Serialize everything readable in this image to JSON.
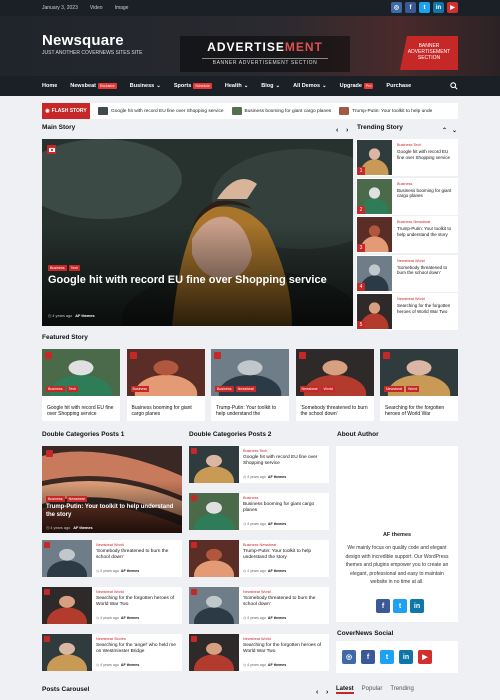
{
  "topbar": {
    "date": "January 3, 2023",
    "links": [
      "Video",
      "Image"
    ]
  },
  "social": [
    {
      "name": "instagram-icon",
      "glyph": "◎",
      "color": "#3e6aa5"
    },
    {
      "name": "facebook-icon",
      "glyph": "f",
      "color": "#3b5998"
    },
    {
      "name": "twitter-icon",
      "glyph": "t",
      "color": "#1da1f2"
    },
    {
      "name": "linkedin-icon",
      "glyph": "in",
      "color": "#0e76a8"
    },
    {
      "name": "youtube-icon",
      "glyph": "▶",
      "color": "#d32f2f"
    }
  ],
  "header": {
    "site_title": "Newsquare",
    "tagline": "JUST ANOTHER COVERNEWS SITES SITE",
    "ad_title_a": "ADVERTISE",
    "ad_title_b": "MENT",
    "ad_sub": "BANNER ADVERTISEMENT SECTION",
    "ad_banner": "BANNER ADVERTISEMENT SECTION"
  },
  "nav": {
    "home": "Home",
    "newsbeat": "Newsbeat",
    "exclusive": "Exclusive",
    "business": "Business",
    "sports": "Sports",
    "schedule": "Schedule",
    "health": "Health",
    "blog": "Blog",
    "all_demos": "All Demos",
    "upgrade": "Upgrade",
    "pro": "Pro",
    "purchase": "Purchase"
  },
  "flash": {
    "label": "FLASH STORY",
    "items": [
      "Google hit with record EU fine over Shopping service",
      "Business booming for giant cargo planes",
      "Trump-Putin: Your toolkit to help unde"
    ]
  },
  "sections": {
    "main": "Main Story",
    "trending": "Trending Story",
    "featured": "Featured Story",
    "dc1": "Double Categories Posts 1",
    "dc2": "Double Categories Posts 2",
    "about": "About Author",
    "social": "CoverNews Social",
    "carousel": "Posts Carousel"
  },
  "main_story": {
    "cats": [
      "Business",
      "Tech"
    ],
    "title": "Google hit with record EU fine over Shopping service",
    "time": "4 years ago",
    "author": "AF themes"
  },
  "trending": [
    {
      "num": "1",
      "cat": "Business Tech",
      "title": "Google hit with record EU fine over Shopping service"
    },
    {
      "num": "2",
      "cat": "Business",
      "title": "Business booming for giant cargo planes"
    },
    {
      "num": "3",
      "cat": "Business Newsbeat",
      "title": "Trump-Putin: Your toolkit to help understand the story"
    },
    {
      "num": "4",
      "cat": "Newsbeat World",
      "title": "'Somebody threatened to burn the school down'"
    },
    {
      "num": "5",
      "cat": "Newsbeat World",
      "title": "Searching for the forgotten heroes of World War Two"
    }
  ],
  "featured": [
    {
      "cats": [
        "Business",
        "Tech"
      ],
      "title": "Google hit with record EU fine over Shopping service"
    },
    {
      "cats": [
        "Business"
      ],
      "title": "Business booming for giant cargo planes"
    },
    {
      "cats": [
        "Business",
        "Newsbeat"
      ],
      "title": "Trump-Putin: Your toolkit to help understand the"
    },
    {
      "cats": [
        "Newsbeat",
        "World"
      ],
      "title": "'Somebody threatened to burn the school down'"
    },
    {
      "cats": [
        "Newsbeat",
        "World"
      ],
      "title": "Searching for the forgotten heroes of World War"
    }
  ],
  "dc1": {
    "big": {
      "cats": [
        "Business",
        "Newsbeat"
      ],
      "title": "Trump-Putin: Your toolkit to help understand the story",
      "time": "4 years ago",
      "author": "AF themes"
    },
    "rows": [
      {
        "cat": "Newsbeat World",
        "title": "'Somebody threatened to burn the school down'",
        "time": "4 years ago",
        "author": "AF themes"
      },
      {
        "cat": "Newsbeat World",
        "title": "Searching for the forgotten heroes of World War Two",
        "time": "4 years ago",
        "author": "AF themes"
      },
      {
        "cat": "Newsbeat Stories",
        "title": "Searching for the 'angel' who held me on Westminster Bridge",
        "time": "4 years ago",
        "author": "AF themes"
      }
    ]
  },
  "dc2": [
    {
      "cat": "Business Tech",
      "title": "Google hit with record EU fine over Shopping service",
      "time": "4 years ago",
      "author": "AF themes"
    },
    {
      "cat": "Business",
      "title": "Business booming for giant cargo planes",
      "time": "4 years ago",
      "author": "AF themes"
    },
    {
      "cat": "Business Newsbeat",
      "title": "Trump-Putin: Your toolkit to help understand the story",
      "time": "4 years ago",
      "author": "AF themes"
    },
    {
      "cat": "Newsbeat World",
      "title": "'Somebody threatened to burn the school down'",
      "time": "4 years ago",
      "author": "AF themes"
    },
    {
      "cat": "Newsbeat World",
      "title": "Searching for the forgotten heroes of World War Two",
      "time": "4 years ago",
      "author": "AF themes"
    }
  ],
  "about": {
    "name": "AF themes",
    "desc": "We mainly focus on quality code and elegant design with incredible support. Our WordPress themes and plugins empower you to create an elegant, professional and easy to maintain website in no time at all."
  },
  "tabs": [
    "Latest",
    "Popular",
    "Trending"
  ],
  "colors": {
    "accent": "#c62828",
    "dark": "#1b1f26"
  }
}
